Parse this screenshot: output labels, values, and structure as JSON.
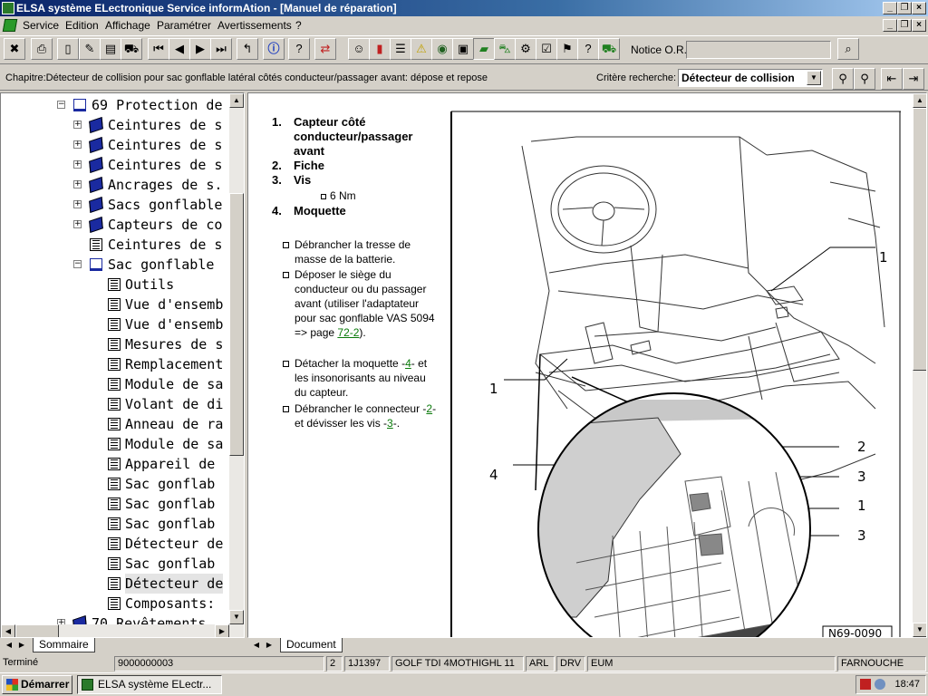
{
  "window": {
    "title": "ELSA système ELectronique Service informAtion - [Manuel de réparation]"
  },
  "menu": [
    "Service",
    "Edition",
    "Affichage",
    "Paramétrer",
    "Avertissements",
    "?"
  ],
  "toolbar": {
    "notice_label": "Notice O.R.:",
    "notice_value": ""
  },
  "chapter": {
    "text": "Chapitre:Détecteur de collision pour sac gonflable latéral côtés conducteur/passager avant: dépose et repose",
    "critere_label": "Critère recherche:",
    "critere_value": "Détecteur de collision"
  },
  "tree": [
    {
      "label": "69 Protection de",
      "level": 0,
      "icon": "openbook",
      "expand": "−"
    },
    {
      "label": "Ceintures de s",
      "level": 1,
      "icon": "book",
      "expand": "+"
    },
    {
      "label": "Ceintures de s",
      "level": 1,
      "icon": "book",
      "expand": "+"
    },
    {
      "label": "Ceintures de s",
      "level": 1,
      "icon": "book",
      "expand": "+"
    },
    {
      "label": "Ancrages de s.",
      "level": 1,
      "icon": "book",
      "expand": "+"
    },
    {
      "label": "Sacs gonflable",
      "level": 1,
      "icon": "book",
      "expand": "+"
    },
    {
      "label": "Capteurs de co",
      "level": 1,
      "icon": "book",
      "expand": "+"
    },
    {
      "label": "Ceintures de s",
      "level": 1,
      "icon": "page",
      "expand": ""
    },
    {
      "label": "Sac gonflable",
      "level": 1,
      "icon": "openbook",
      "expand": "−"
    },
    {
      "label": "Outils",
      "level": 2,
      "icon": "page",
      "expand": ""
    },
    {
      "label": "Vue d'ensemb",
      "level": 2,
      "icon": "page",
      "expand": ""
    },
    {
      "label": "Vue d'ensemb",
      "level": 2,
      "icon": "page",
      "expand": ""
    },
    {
      "label": "Mesures de s",
      "level": 2,
      "icon": "page",
      "expand": ""
    },
    {
      "label": "Remplacement",
      "level": 2,
      "icon": "page",
      "expand": ""
    },
    {
      "label": "Module de sa",
      "level": 2,
      "icon": "page",
      "expand": ""
    },
    {
      "label": "Volant de di",
      "level": 2,
      "icon": "page",
      "expand": ""
    },
    {
      "label": "Anneau de ra",
      "level": 2,
      "icon": "page",
      "expand": ""
    },
    {
      "label": "Module de sa",
      "level": 2,
      "icon": "page",
      "expand": ""
    },
    {
      "label": "Appareil de",
      "level": 2,
      "icon": "page",
      "expand": ""
    },
    {
      "label": "Sac gonflab",
      "level": 2,
      "icon": "page",
      "expand": ""
    },
    {
      "label": "Sac gonflab",
      "level": 2,
      "icon": "page",
      "expand": ""
    },
    {
      "label": "Sac gonflab",
      "level": 2,
      "icon": "page",
      "expand": ""
    },
    {
      "label": "Détecteur de",
      "level": 2,
      "icon": "page",
      "expand": ""
    },
    {
      "label": "Sac gonflab",
      "level": 2,
      "icon": "page",
      "expand": ""
    },
    {
      "label": "Détecteur de",
      "level": 2,
      "icon": "page",
      "expand": "",
      "selected": true
    },
    {
      "label": "Composants:",
      "level": 2,
      "icon": "page",
      "expand": ""
    },
    {
      "label": "70 Revêtements",
      "level": 0,
      "icon": "book",
      "expand": "+"
    }
  ],
  "left_tab": "Sommaire",
  "right_tab": "Document",
  "doc": {
    "legend": [
      {
        "num": "1.",
        "text": "Capteur côté conducteur/passager avant"
      },
      {
        "num": "2.",
        "text": "Fiche"
      },
      {
        "num": "3.",
        "text": "Vis"
      },
      {
        "num": "4.",
        "text": "Moquette"
      }
    ],
    "torque": "6 Nm",
    "steps": [
      {
        "text": "Débrancher la tresse de masse de la batterie."
      },
      {
        "pre": "Déposer le siège du conducteur ou du passager avant (utiliser l'adaptateur pour sac gonflable VAS 5094 => page ",
        "link": "72-2",
        "post": ")."
      },
      {
        "pre": "Détacher la moquette -",
        "ref1": "4",
        "post": "- et les insonorisants au niveau du capteur."
      },
      {
        "pre": "Débrancher le connecteur -",
        "ref1": "2",
        "mid": "- et dévisser les vis -",
        "ref2": "3",
        "post": "-."
      }
    ],
    "figure_id": "N69-0090",
    "callouts": [
      "1",
      "1",
      "2",
      "3",
      "1",
      "3",
      "4"
    ]
  },
  "status": {
    "state": "Terminé",
    "number": "9000000003",
    "page": "2",
    "code": "1J1397",
    "model": "GOLF TDI 4MOTHIGHL 11",
    "c1": "ARL",
    "c2": "DRV",
    "c3": "EUM",
    "user": "FARNOUCHE"
  },
  "taskbar": {
    "start": "Démarrer",
    "item": "ELSA système ELectr...",
    "clock": "18:47"
  }
}
